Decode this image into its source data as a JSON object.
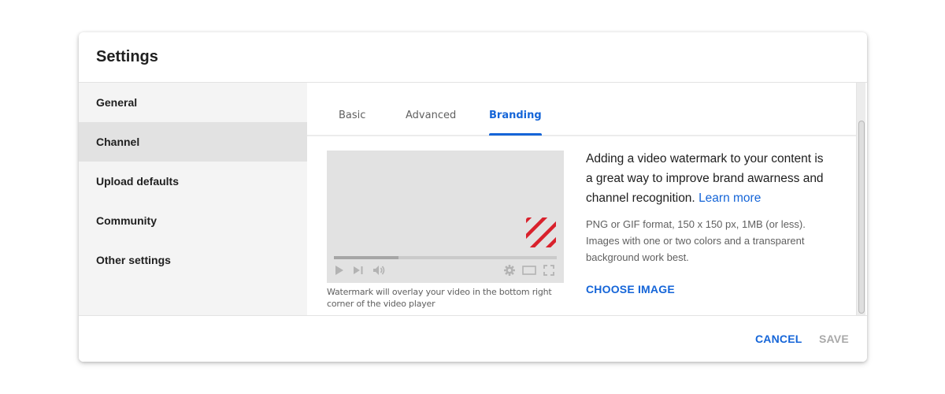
{
  "dialog": {
    "title": "Settings"
  },
  "sidebar": {
    "items": [
      {
        "label": "General",
        "active": false
      },
      {
        "label": "Channel",
        "active": true
      },
      {
        "label": "Upload defaults",
        "active": false
      },
      {
        "label": "Community",
        "active": false
      },
      {
        "label": "Other settings",
        "active": false
      }
    ]
  },
  "tabs": [
    {
      "label": "Basic",
      "active": false
    },
    {
      "label": "Advanced",
      "active": false
    },
    {
      "label": "Branding",
      "active": true
    }
  ],
  "preview": {
    "progress_percent": 29,
    "caption": "Watermark will overlay your video in the bottom right corner of the video player",
    "icons": [
      "play-icon",
      "skip-next-icon",
      "volume-icon",
      "settings-gear-icon",
      "theater-mode-icon",
      "fullscreen-icon"
    ],
    "watermark_color": "#d9212c"
  },
  "branding": {
    "description": "Adding a video watermark to your content is a great way to improve brand awarness and channel recognition.",
    "learn_more": "Learn more",
    "requirements": "PNG or GIF format, 150 x 150 px, 1MB (or less). Images with one or two colors and a transparent background work best.",
    "choose_image": "CHOOSE IMAGE"
  },
  "footer": {
    "cancel": "CANCEL",
    "save": "SAVE",
    "save_disabled": true
  },
  "colors": {
    "accent": "#1565d8",
    "disabled": "#a9a9a9",
    "sidebar_bg": "#f4f4f4",
    "sidebar_active_bg": "#e2e2e2"
  }
}
